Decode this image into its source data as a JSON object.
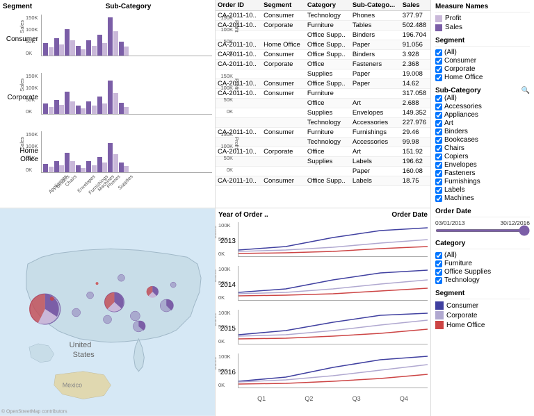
{
  "header": {
    "segment_label": "Segment",
    "sub_category_label": "Sub-Category"
  },
  "bar_charts": {
    "rows": [
      {
        "segment": "Consumer",
        "sales_bars": [
          30,
          25,
          35,
          20,
          40,
          55,
          70,
          45
        ],
        "profit_bars": [
          20,
          15,
          25,
          12,
          28,
          35,
          50,
          30
        ],
        "y_labels": [
          "150K",
          "100K",
          "50K",
          "0K"
        ],
        "y_right": [
          "150K",
          "100K",
          "50K",
          "0K"
        ]
      },
      {
        "segment": "Corporate",
        "sales_bars": [
          20,
          22,
          28,
          15,
          35,
          45,
          60,
          38
        ],
        "profit_bars": [
          14,
          12,
          20,
          10,
          22,
          30,
          40,
          25
        ],
        "y_labels": [
          "150K",
          "100K",
          "50K",
          "0K"
        ],
        "y_right": [
          "150K",
          "100K",
          "50K",
          "0K"
        ]
      },
      {
        "segment": "Home Office",
        "sales_bars": [
          15,
          18,
          22,
          12,
          28,
          38,
          50,
          32
        ],
        "profit_bars": [
          10,
          10,
          16,
          8,
          18,
          25,
          35,
          20
        ],
        "y_labels": [
          "150K",
          "100K",
          "50K",
          "0K"
        ],
        "y_right": [
          "150K",
          "100K",
          "50K",
          "0K"
        ]
      }
    ],
    "x_labels": [
      "Appliances",
      "Binders",
      "Chairs",
      "Envelopes",
      "Furnishings",
      "Machines",
      "Phones",
      "Supplies"
    ]
  },
  "table": {
    "headers": [
      "Order ID",
      "Segment",
      "Category",
      "Sub-Catego...",
      "Sales"
    ],
    "rows": [
      [
        "CA-2011-10..",
        "Consumer",
        "Technology",
        "Phones",
        "377.97"
      ],
      [
        "CA-2011-10..",
        "Corporate",
        "Furniture",
        "Tables",
        "502.488"
      ],
      [
        "",
        "",
        "Office Supp..",
        "Binders",
        "196.704"
      ],
      [
        "CA-2011-10..",
        "Home Office",
        "Office Supp..",
        "Paper",
        "91.056"
      ],
      [
        "CA-2011-10..",
        "Consumer",
        "Office Supp..",
        "Binders",
        "3.928"
      ],
      [
        "CA-2011-10..",
        "Corporate",
        "Office",
        "Fasteners",
        "2.368"
      ],
      [
        "",
        "",
        "Supplies",
        "Paper",
        "19.008"
      ],
      [
        "CA-2011-10..",
        "Consumer",
        "Office Supp..",
        "Paper",
        "14.62"
      ],
      [
        "CA-2011-10..",
        "Consumer",
        "Furniture",
        "317.058"
      ],
      [
        "",
        "",
        "Office",
        "Art",
        "2.688"
      ],
      [
        "",
        "",
        "Supplies",
        "Envelopes",
        "149.352"
      ],
      [
        "",
        "",
        "Technology",
        "Accessories",
        "227.976"
      ],
      [
        "CA-2011-10..",
        "Consumer",
        "Furniture",
        "Furnishings",
        "29.46"
      ],
      [
        "",
        "",
        "Technology",
        "Accessories",
        "99.98"
      ],
      [
        "CA-2011-10..",
        "Corporate",
        "Office",
        "Art",
        "151.92"
      ],
      [
        "",
        "",
        "Supplies",
        "Labels",
        "196.62"
      ],
      [
        "",
        "",
        "",
        "Paper",
        "160.08"
      ],
      [
        "CA-2011-10..",
        "Consumer",
        "Office Supp..",
        "Labels",
        "18.75"
      ]
    ]
  },
  "line_charts": {
    "title_left": "Year of Order ..",
    "title_right": "Order Date",
    "years": [
      "2013",
      "2014",
      "2015",
      "2016"
    ],
    "y_labels": [
      "100K",
      "50K",
      "0K"
    ],
    "q_labels": [
      "Q1",
      "Q2",
      "Q3",
      "Q4"
    ],
    "series": {
      "consumer": "#4040a0",
      "corporate": "#b8b8d8",
      "home_office": "#cc4444"
    }
  },
  "right_panel": {
    "measure_names_title": "Measure Names",
    "measures": [
      {
        "label": "Profit",
        "color": "#c9b8d9"
      },
      {
        "label": "Sales",
        "color": "#7b5ea7"
      }
    ],
    "segment_title": "Segment",
    "segment_items": [
      "(All)",
      "Consumer",
      "Corporate",
      "Home Office"
    ],
    "sub_category_title": "Sub-Category",
    "sub_category_items": [
      "(All)",
      "Accessories",
      "Appliances",
      "Art",
      "Binders",
      "Bookcases",
      "Chairs",
      "Copiers",
      "Envelopes",
      "Fasteners",
      "Furnishings",
      "Labels",
      "Machines"
    ],
    "order_date_title": "Order Date",
    "order_date_start": "03/01/2013",
    "order_date_end": "30/12/2016",
    "category_title": "Category",
    "category_items": [
      "(All)",
      "Furniture",
      "Office Supplies",
      "Technology"
    ],
    "segment_color_title": "Segment",
    "segment_colors": [
      {
        "label": "Consumer",
        "color": "#4040a0"
      },
      {
        "label": "Corporate",
        "color": "#b0a8d0"
      },
      {
        "label": "Home Office",
        "color": "#cc4444"
      }
    ]
  },
  "map": {
    "attribution": "© OpenStreetMap contributors"
  }
}
